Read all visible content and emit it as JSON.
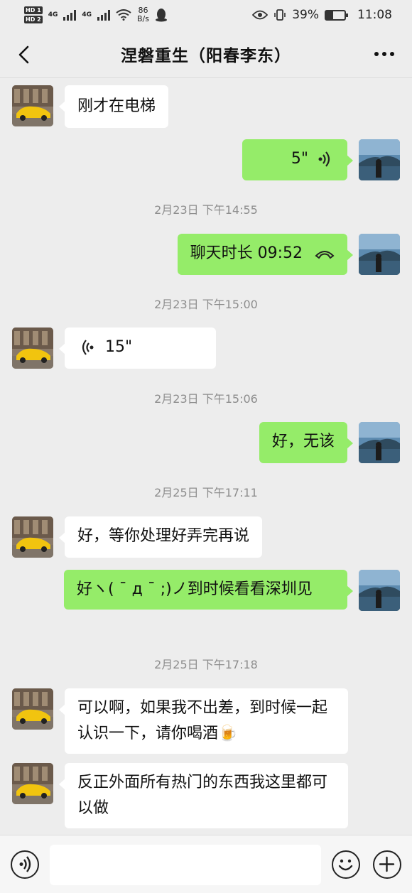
{
  "status_bar": {
    "sim1": "HD 1",
    "sim2": "HD 2",
    "net1": "4G",
    "net2": "4G",
    "speed_value": "86",
    "speed_unit": "B/s",
    "battery_percent": "39%",
    "battery_level": 0.39,
    "time": "11:08"
  },
  "header": {
    "title": "涅磐重生（阳春李东）"
  },
  "messages": [
    {
      "side": "in",
      "text": "刚才在电梯"
    },
    {
      "side": "out",
      "type": "voice",
      "text": "5\""
    },
    {
      "type": "time",
      "text": "2月23日 下午14:55"
    },
    {
      "side": "out",
      "type": "call",
      "text": "聊天时长 09:52"
    },
    {
      "type": "time",
      "text": "2月23日 下午15:00"
    },
    {
      "side": "in",
      "type": "voice",
      "text": "15\""
    },
    {
      "type": "time",
      "text": "2月23日 下午15:06"
    },
    {
      "side": "out",
      "text": "好，无该"
    },
    {
      "type": "time",
      "text": "2月25日 下午17:11"
    },
    {
      "side": "in",
      "text": "好，等你处理好弄完再说"
    },
    {
      "side": "out",
      "text": "好ヽ( ¯ д ¯ ;)ノ到时候看看深圳见"
    },
    {
      "type": "time",
      "text": "2月25日 下午17:18"
    },
    {
      "side": "in",
      "text": "可以啊，如果我不出差，到时候一起认识一下，请你喝酒🍺"
    },
    {
      "side": "in",
      "text": "反正外面所有热门的东西我这里都可以做"
    }
  ],
  "input": {
    "value": "",
    "placeholder": ""
  },
  "colors": {
    "outgoing_bubble": "#95ec69",
    "incoming_bubble": "#ffffff",
    "background": "#ededed"
  }
}
